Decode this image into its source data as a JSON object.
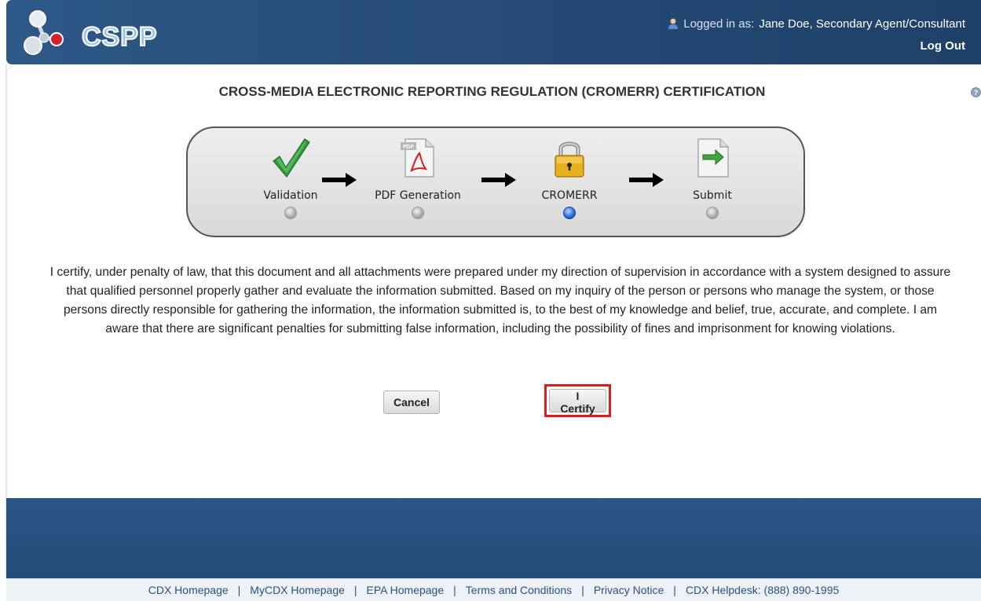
{
  "header": {
    "logo_text": "CSPP",
    "login_prefix": "Logged in as:",
    "user_name": "Jane Doe, Secondary Agent/Consultant",
    "logout_label": "Log Out",
    "user_icon": "user-icon"
  },
  "page": {
    "title": "CROSS-MEDIA ELECTRONIC REPORTING REGULATION (CROMERR) CERTIFICATION",
    "help_icon": "help-icon"
  },
  "progress": {
    "steps": [
      {
        "label": "Validation",
        "icon": "checkmark-icon",
        "active": false
      },
      {
        "label": "PDF Generation",
        "icon": "pdf-icon",
        "active": false
      },
      {
        "label": "CROMERR",
        "icon": "lock-icon",
        "active": true
      },
      {
        "label": "Submit",
        "icon": "submit-document-icon",
        "active": false
      }
    ],
    "pdf_badge": "PDF"
  },
  "certification": {
    "text": "I certify, under penalty of law, that this document and all attachments were prepared under my direction of supervision in accordance with a system designed to assure that qualified personnel properly gather and evaluate the information submitted. Based on my inquiry of the person or persons who manage the system, or those persons directly responsible for gathering the information, the information submitted is, to the best of my knowledge and belief, true, accurate, and complete. I am aware that there are significant penalties for submitting false information, including the possibility of fines and imprisonment for knowing violations."
  },
  "buttons": {
    "cancel": "Cancel",
    "certify": "I Certify"
  },
  "footer": {
    "links": [
      "CDX Homepage",
      "MyCDX Homepage",
      "EPA Homepage",
      "Terms and Conditions",
      "Privacy Notice",
      "CDX Helpdesk: (888) 890-1995"
    ],
    "separator": "|"
  },
  "colors": {
    "header_blue": "#2e5888",
    "highlight_red": "#e11b1b",
    "active_step_blue": "#2f6fe0",
    "link_blue": "#2c4f86"
  }
}
